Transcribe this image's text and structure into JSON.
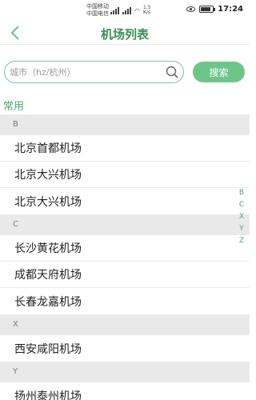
{
  "status_bar": {
    "carrier_1": "中国移动",
    "carrier_2": "中国电信",
    "speed": "1.5 K/s",
    "time": "17:24"
  },
  "header": {
    "title": "机场列表",
    "back_icon": "chevron-left-icon"
  },
  "search": {
    "placeholder": "城市（hz/杭州）",
    "button_label": "搜索",
    "icon": "search-icon"
  },
  "common_label": "常用",
  "groups": [
    {
      "letter": "B",
      "items": [
        "北京首都机场",
        "北京大兴机场",
        "北京大兴机场"
      ]
    },
    {
      "letter": "C",
      "items": [
        "长沙黄花机场",
        "成都天府机场",
        "长春龙嘉机场"
      ]
    },
    {
      "letter": "X",
      "items": [
        "西安咸阳机场"
      ]
    },
    {
      "letter": "Y",
      "items": [
        "扬州泰州机场"
      ]
    }
  ],
  "index": [
    "B",
    "C",
    "X",
    "Y",
    "Z"
  ],
  "colors": {
    "accent": "#3a8f5a",
    "button": "#6cc687",
    "section_bg": "#e9e9e9"
  }
}
